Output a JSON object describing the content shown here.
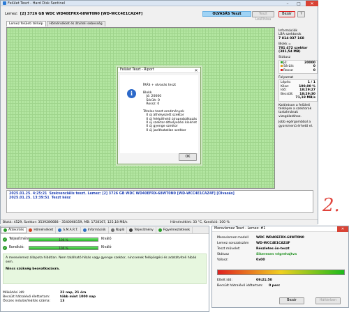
{
  "main_window": {
    "title": "Felület Teszt - Hard Disk Sentinel",
    "disk_label": "Lemez:",
    "disk_value": "[2] 3726 GB  WDC WD40EFRX-68WT0N0 [WD-WCC4E1CAZ4F]",
    "status_badge": "OLVASÁS Teszt",
    "pause_button": "Teszt Leállítása",
    "close_button": "Bezár",
    "tabs": [
      "Lemez felületi térkép",
      "Hőmérséklet és átviteli sebesség"
    ]
  },
  "side_panel": {
    "info_title": "Információk",
    "lba_label": "LBA szektorok",
    "lba_value": "7 814 037 168",
    "block_label": "Blokk =",
    "block_value": "781 472 szektor",
    "block_size": "(381,54 MB)",
    "status_title": "Státusz",
    "status_rows": [
      {
        "label": "Jó:",
        "value": "20000",
        "color": "#2aa52a"
      },
      {
        "label": "Sérült:",
        "value": "0",
        "color": "#e0a020"
      },
      {
        "label": "Rossz:",
        "value": "0",
        "color": "#d92020"
      }
    ],
    "progress_title": "Folyamat",
    "progress_rows": [
      {
        "label": "Lépés:",
        "value": "1 / 1"
      },
      {
        "label": "Kész:",
        "value": "100,00 %"
      },
      {
        "label": "Idő:",
        "value": "18:29:27"
      },
      {
        "label": "Becsült:",
        "value": "18:29:30"
      },
      {
        "label": "",
        "value": "71,18 MB/s"
      }
    ],
    "note1": "Kattintson a felületi térképre a szektorok tartalmának vizsgálatához.",
    "note2": "Jobb egérgombbal a gyorsmenü érhető el."
  },
  "report_dialog": {
    "title": "Felület Teszt - Riport",
    "lines": [
      "ÍRÁS + olvasás teszt",
      "",
      "Blokk",
      "   Jó: 20000",
      "   Sérült: 0",
      "   Rossz: 0",
      "",
      "Tételes teszt eredmények",
      "   0 új áthelyezett szektor",
      "   0 új felépíthető újraprobálkozás",
      "   0 új szektor-áthelyezési kísérlet",
      "   0 új gyenge szektor",
      "   0 új javíthatatlan szektor"
    ],
    "ok_button": "OK"
  },
  "log": {
    "line1_time": "2025.01.25.   4:25:21",
    "line1_text": "Szekvenciális teszt. Lemez: [2] 3726 GB  WDC WD40EFRX-68WT0N0 [WD-WCC4E1CAZ4F] [Olvasás]",
    "line2_time": "2025.01.25.  13:39:51",
    "line2_text": "Teszt kész"
  },
  "statusbar": {
    "left": "Blokk: 4529, Szektor: 3539286688 - 3540068159, MB: 1728167, 125,18 MB/s",
    "right": "Hőmérséklet: 33 °C,  Kondíció: 100 %"
  },
  "handwritten_mark": "2.",
  "bottom_panel": {
    "tabs": [
      {
        "label": "Áttekintés",
        "color": "#2a9d2a"
      },
      {
        "label": "Hőmérséklet",
        "color": "#d04020"
      },
      {
        "label": "S.M.A.R.T.",
        "color": "#3070c0"
      },
      {
        "label": "Információk",
        "color": "#3070c0"
      },
      {
        "label": "Napló",
        "color": "#707070"
      },
      {
        "label": "Teljesítmény",
        "color": "#404040"
      },
      {
        "label": "Figyelmeztetések",
        "color": "#2a9d2a"
      }
    ],
    "performance_label": "Teljesítmény:",
    "performance_pct": "100 %",
    "performance_fill": 100,
    "performance_word": "Kiváló",
    "condition_label": "Kondíció:",
    "condition_pct": "100 %",
    "condition_fill": 100,
    "condition_word": "Kiváló",
    "message": "A merevlemez állapota hibátlan. Nem található hibás vagy gyenge szektor, nincsenek felépörgési és adatátviteli hibák sem.",
    "advice": "Nincs szükség beavatkozásra.",
    "stats": [
      {
        "label": "Működési idő:",
        "value": "22 nap, 21 óra"
      },
      {
        "label": "Becsült hátralévő élettartam:",
        "value": "több mint 1000 nap"
      },
      {
        "label": "Összes indulás/leállás száma:",
        "value": "13"
      }
    ]
  },
  "erase_dialog": {
    "title": "Merevlemez Teszt - Lemez: #1",
    "rows": [
      {
        "label": "Merevlemez modell",
        "value": "WDC WD40EFRX-68WT0N0"
      },
      {
        "label": "Lemez sorozatszám",
        "value": "WD-WCC4E1CAZ4F"
      },
      {
        "label": "Teszt művelet:",
        "value": "Részletes ön-teszt"
      },
      {
        "label": "Státusz",
        "value": "Sikeresen végrehajtva"
      },
      {
        "label": "Válasz:",
        "value": "0x00"
      }
    ],
    "elapsed_label": "Eltelt idő:",
    "elapsed_value": "09:21:50",
    "remaining_label": "Becsült hátralévő időtartam:",
    "remaining_value": "0 perc",
    "close_button": "Bezár",
    "stop_button": "Háttérben",
    "progress_fill": 100
  }
}
